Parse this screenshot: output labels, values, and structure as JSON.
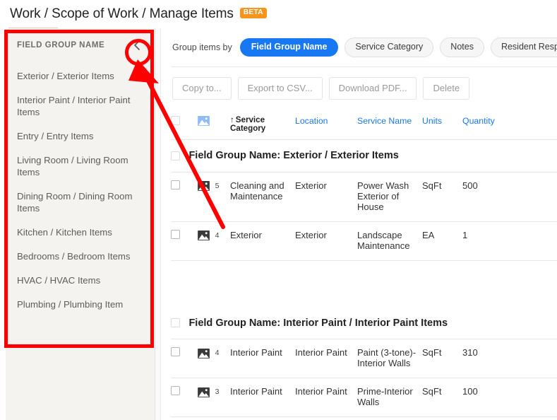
{
  "header": {
    "title": "Work / Scope of Work / Manage Items",
    "badge": "BETA"
  },
  "sidebar": {
    "heading": "FIELD GROUP NAME",
    "collapse_icon": "chevron-left-icon",
    "items": [
      {
        "label": "Exterior / Exterior Items"
      },
      {
        "label": "Interior Paint / Interior Paint Items"
      },
      {
        "label": "Entry / Entry Items"
      },
      {
        "label": "Living Room / Living Room Items"
      },
      {
        "label": "Dining Room / Dining Room Items"
      },
      {
        "label": "Kitchen / Kitchen Items"
      },
      {
        "label": "Bedrooms / Bedroom Items"
      },
      {
        "label": "HVAC / HVAC Items"
      },
      {
        "label": "Plumbing / Plumbing Item"
      }
    ]
  },
  "toolbar": {
    "group_by_label": "Group items by",
    "group_by_options": [
      {
        "label": "Field Group Name",
        "active": true
      },
      {
        "label": "Service Category",
        "active": false
      },
      {
        "label": "Notes",
        "active": false
      },
      {
        "label": "Resident Responsible",
        "active": false
      }
    ],
    "actions": [
      {
        "label": "Copy to..."
      },
      {
        "label": "Export to CSV..."
      },
      {
        "label": "Download PDF..."
      },
      {
        "label": "Delete"
      }
    ]
  },
  "table": {
    "columns": [
      {
        "label": "",
        "name": "select-all",
        "sorted": false
      },
      {
        "label": "",
        "name": "image",
        "sorted": false
      },
      {
        "label": "Service Category",
        "name": "service-category",
        "sorted": true,
        "sort_dir": "↑"
      },
      {
        "label": "Location",
        "name": "location",
        "sorted": false
      },
      {
        "label": "Service Name",
        "name": "service-name",
        "sorted": false
      },
      {
        "label": "Units",
        "name": "units",
        "sorted": false
      },
      {
        "label": "Quantity",
        "name": "quantity",
        "sorted": false
      }
    ],
    "groups": [
      {
        "title": "Field Group Name: Exterior / Exterior Items",
        "rows": [
          {
            "image_count": "5",
            "service_category": "Cleaning and Maintenance",
            "location": "Exterior",
            "service_name": "Power Wash Exterior of House",
            "units": "SqFt",
            "quantity": "500"
          },
          {
            "image_count": "4",
            "service_category": "Exterior",
            "location": "Exterior",
            "service_name": "Landscape Maintenance",
            "units": "EA",
            "quantity": "1"
          }
        ]
      },
      {
        "title": "Field Group Name: Interior Paint / Interior Paint Items",
        "rows": [
          {
            "image_count": "4",
            "service_category": "Interior Paint",
            "location": "Interior Paint",
            "service_name": "Paint (3-tone)-Interior Walls",
            "units": "SqFt",
            "quantity": "310"
          },
          {
            "image_count": "3",
            "service_category": "Interior Paint",
            "location": "Interior Paint",
            "service_name": "Prime-Interior Walls",
            "units": "SqFt",
            "quantity": "100"
          }
        ]
      }
    ]
  },
  "annotations": {
    "highlight_color": "#ff0000",
    "box_target": "sidebar-field-group-panel",
    "circle_target": "sidebar-collapse-button",
    "arrow": "points-from-collapse-button-down-into-table"
  },
  "colors": {
    "accent_blue": "#1877f2",
    "badge_orange": "#f7941e",
    "sidebar_bg": "#f4f3f0",
    "annotation_red": "#ff0000"
  }
}
